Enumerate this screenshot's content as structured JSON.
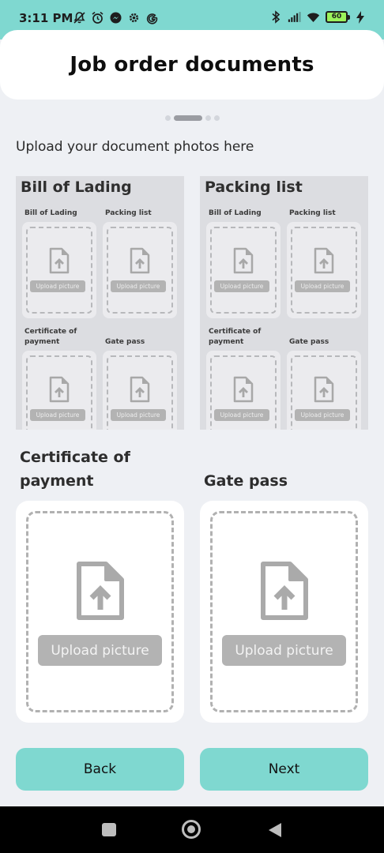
{
  "status_bar": {
    "time": "3:11 PM",
    "battery_level": "60",
    "left_icons": [
      "muted-notification-icon",
      "alarm-icon",
      "messenger-icon",
      "settings-gear-icon",
      "google-icon"
    ],
    "right_icons": [
      "bluetooth-icon",
      "signal-bars-icon",
      "wifi-icon",
      "battery-icon",
      "charging-icon"
    ]
  },
  "header": {
    "title": "Job order documents"
  },
  "pager": {
    "total": 4,
    "active_index": 1
  },
  "instruction": "Upload your document photos here",
  "previews": [
    {
      "title": "Bill of Lading",
      "labels": {
        "a": "Bill of Lading",
        "b": "Packing list",
        "c": "Certificate of payment",
        "d": "Gate pass"
      },
      "button": "Upload picture"
    },
    {
      "title": "Packing list",
      "labels": {
        "a": "Bill of Lading",
        "b": "Packing list",
        "c": "Certificate of payment",
        "d": "Gate pass"
      },
      "button": "Upload picture"
    }
  ],
  "uploads": [
    {
      "label": "Certificate of payment",
      "button": "Upload picture"
    },
    {
      "label": "Gate pass",
      "button": "Upload picture"
    }
  ],
  "actions": {
    "back": "Back",
    "next": "Next"
  },
  "colors": {
    "accent": "#7fd8d0",
    "background": "#eef0f4",
    "upload_button": "#b3b3b3"
  }
}
